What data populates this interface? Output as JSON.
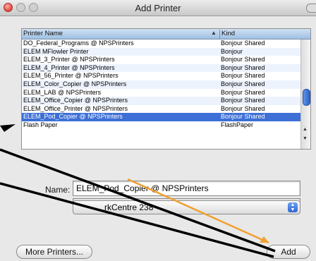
{
  "window": {
    "title": "Add Printer"
  },
  "printer_list": {
    "columns": {
      "name": "Printer Name",
      "kind": "Kind"
    },
    "rows": [
      {
        "name": "DO_Federal_Programs @ NPSPrinters",
        "kind": "Bonjour Shared"
      },
      {
        "name": "ELEM MFlowler Printer",
        "kind": "Bonjour"
      },
      {
        "name": "ELEM_3_Printer @ NPSPrinters",
        "kind": "Bonjour Shared"
      },
      {
        "name": "ELEM_4_Printer @ NPSPrinters",
        "kind": "Bonjour Shared"
      },
      {
        "name": "ELEM_56_Printer @ NPSPrinters",
        "kind": "Bonjour Shared"
      },
      {
        "name": "ELEM_Color_Copier @ NPSPrinters",
        "kind": "Bonjour Shared"
      },
      {
        "name": "ELEM_LAB @ NPSPrinters",
        "kind": "Bonjour Shared"
      },
      {
        "name": "ELEM_Office_Copier @ NPSPrinters",
        "kind": "Bonjour Shared"
      },
      {
        "name": "ELEM_Office_Printer @ NPSPrinters",
        "kind": "Bonjour Shared"
      },
      {
        "name": "ELEM_Pod_Copier @ NPSPrinters",
        "kind": "Bonjour Shared"
      },
      {
        "name": "Flash Paper",
        "kind": "FlashPaper"
      }
    ],
    "selected_index": 9
  },
  "form": {
    "name_label": "Name:",
    "name_value": "ELEM_Pod_Copier @ NPSPrinters",
    "print_using_visible": "rkCentre 238"
  },
  "buttons": {
    "more_printers": "More Printers...",
    "add": "Add"
  },
  "colors": {
    "selection": "#3d6fd6",
    "annotation_arrow": "#f0a030",
    "annotation_lines": "#000000"
  }
}
